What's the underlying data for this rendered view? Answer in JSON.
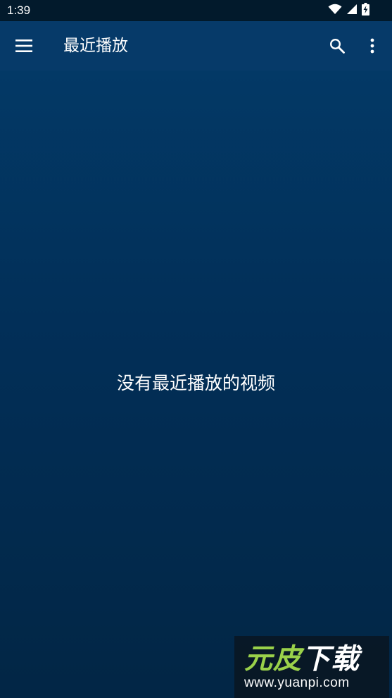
{
  "status_bar": {
    "time": "1:39",
    "icons": [
      "wifi-icon",
      "cell-signal-icon",
      "battery-charging-icon"
    ]
  },
  "app_bar": {
    "title": "最近播放",
    "icons": [
      "hamburger-menu-icon",
      "search-icon",
      "more-vert-icon"
    ]
  },
  "main": {
    "empty_message": "没有最近播放的视频"
  },
  "watermark": {
    "logo_part1": "元皮",
    "logo_part2": "下载",
    "url": "www.yuanpi.com"
  },
  "colors": {
    "status_bar_bg": "#021a2c",
    "app_bar_bg": "#063a69",
    "content_top": "#033966",
    "content_bottom": "#022645",
    "text": "#ffffff",
    "watermark_green": "#9ad14a"
  }
}
